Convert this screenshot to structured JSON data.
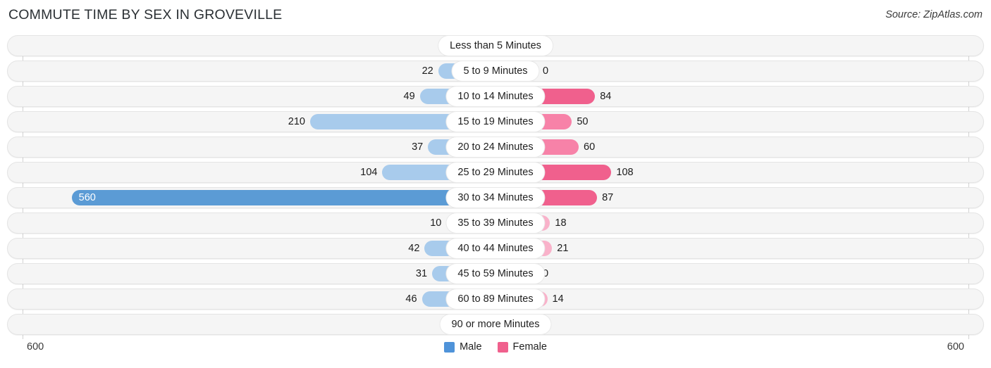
{
  "header": {
    "title": "COMMUTE TIME BY SEX IN GROVEVILLE",
    "source": "Source: ZipAtlas.com"
  },
  "legend": {
    "items": [
      {
        "label": "Male",
        "color": "#4f93d9"
      },
      {
        "label": "Female",
        "color": "#f0608d"
      }
    ]
  },
  "axis": {
    "left_label": "600",
    "right_label": "600",
    "max": 600
  },
  "chart_data": {
    "type": "bar",
    "orientation": "horizontal-diverging",
    "title": "COMMUTE TIME BY SEX IN GROVEVILLE",
    "xlabel": "",
    "ylabel": "",
    "xlim": [
      600,
      600
    ],
    "grid": false,
    "legend_position": "bottom-center",
    "categories": [
      "Less than 5 Minutes",
      "5 to 9 Minutes",
      "10 to 14 Minutes",
      "15 to 19 Minutes",
      "20 to 24 Minutes",
      "25 to 29 Minutes",
      "30 to 34 Minutes",
      "35 to 39 Minutes",
      "40 to 44 Minutes",
      "45 to 59 Minutes",
      "60 to 89 Minutes",
      "90 or more Minutes"
    ],
    "series": [
      {
        "name": "Male",
        "side": "left",
        "values": [
          0,
          22,
          49,
          210,
          37,
          104,
          560,
          10,
          42,
          31,
          46,
          0
        ]
      },
      {
        "name": "Female",
        "side": "right",
        "values": [
          0,
          0,
          84,
          50,
          60,
          108,
          87,
          18,
          21,
          0,
          14,
          0
        ]
      }
    ]
  }
}
